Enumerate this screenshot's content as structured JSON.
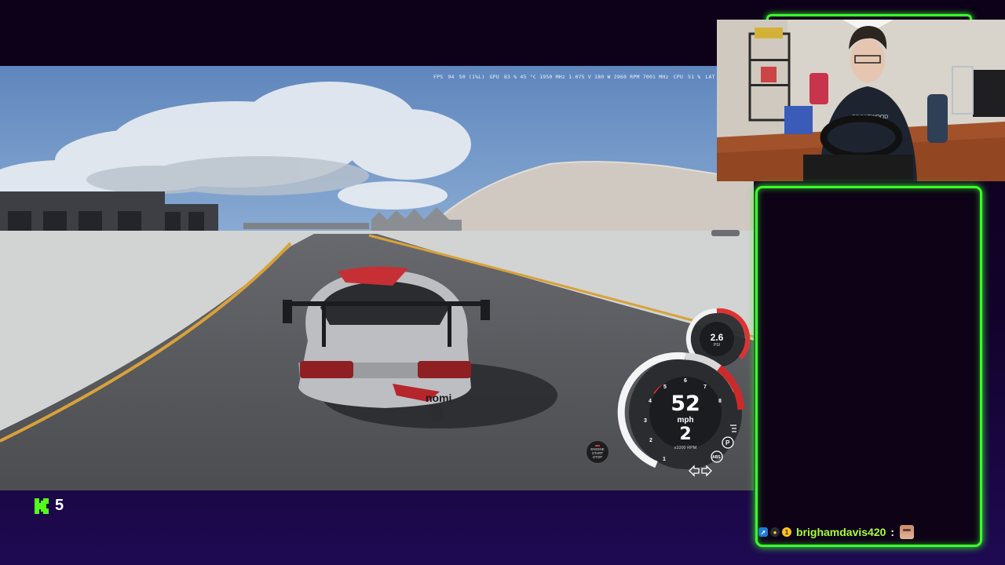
{
  "perf_overlay": {
    "fps_label": "FPS",
    "fps_value": "94",
    "fps_low": "50 (1%L)",
    "gpu_label": "GPU",
    "gpu_stats": "83 % 45 °C 1950 MHz 1.075 V 180 W 2960 RPM 7001 MHz",
    "cpu_label": "CPU",
    "cpu_stats": "51 %",
    "lat_label": "LAT"
  },
  "dashboard": {
    "speed": "52",
    "speed_unit": "mph",
    "gear": "2",
    "rpm_label": "x1000 RPM",
    "rpm_ticks": [
      "1",
      "2",
      "3",
      "4",
      "5",
      "6",
      "7",
      "8"
    ],
    "boost_value": "2.6",
    "boost_unit": "PSI",
    "engine_button": [
      "ENGINE",
      "START",
      "STOP"
    ],
    "indicators": [
      "headlight-icon",
      "parking-icon",
      "abs-icon",
      "turn-left-icon",
      "turn-right-icon"
    ]
  },
  "car": {
    "livery_text": "nomi"
  },
  "chat": {
    "username": "brighamdavis420",
    "separator": ":"
  },
  "kick": {
    "viewer_count": "5"
  },
  "colors": {
    "accent_green": "#3cff2c",
    "chat_name": "#a6ff3a",
    "kick_green": "#53fc18",
    "background": "#12022a"
  }
}
